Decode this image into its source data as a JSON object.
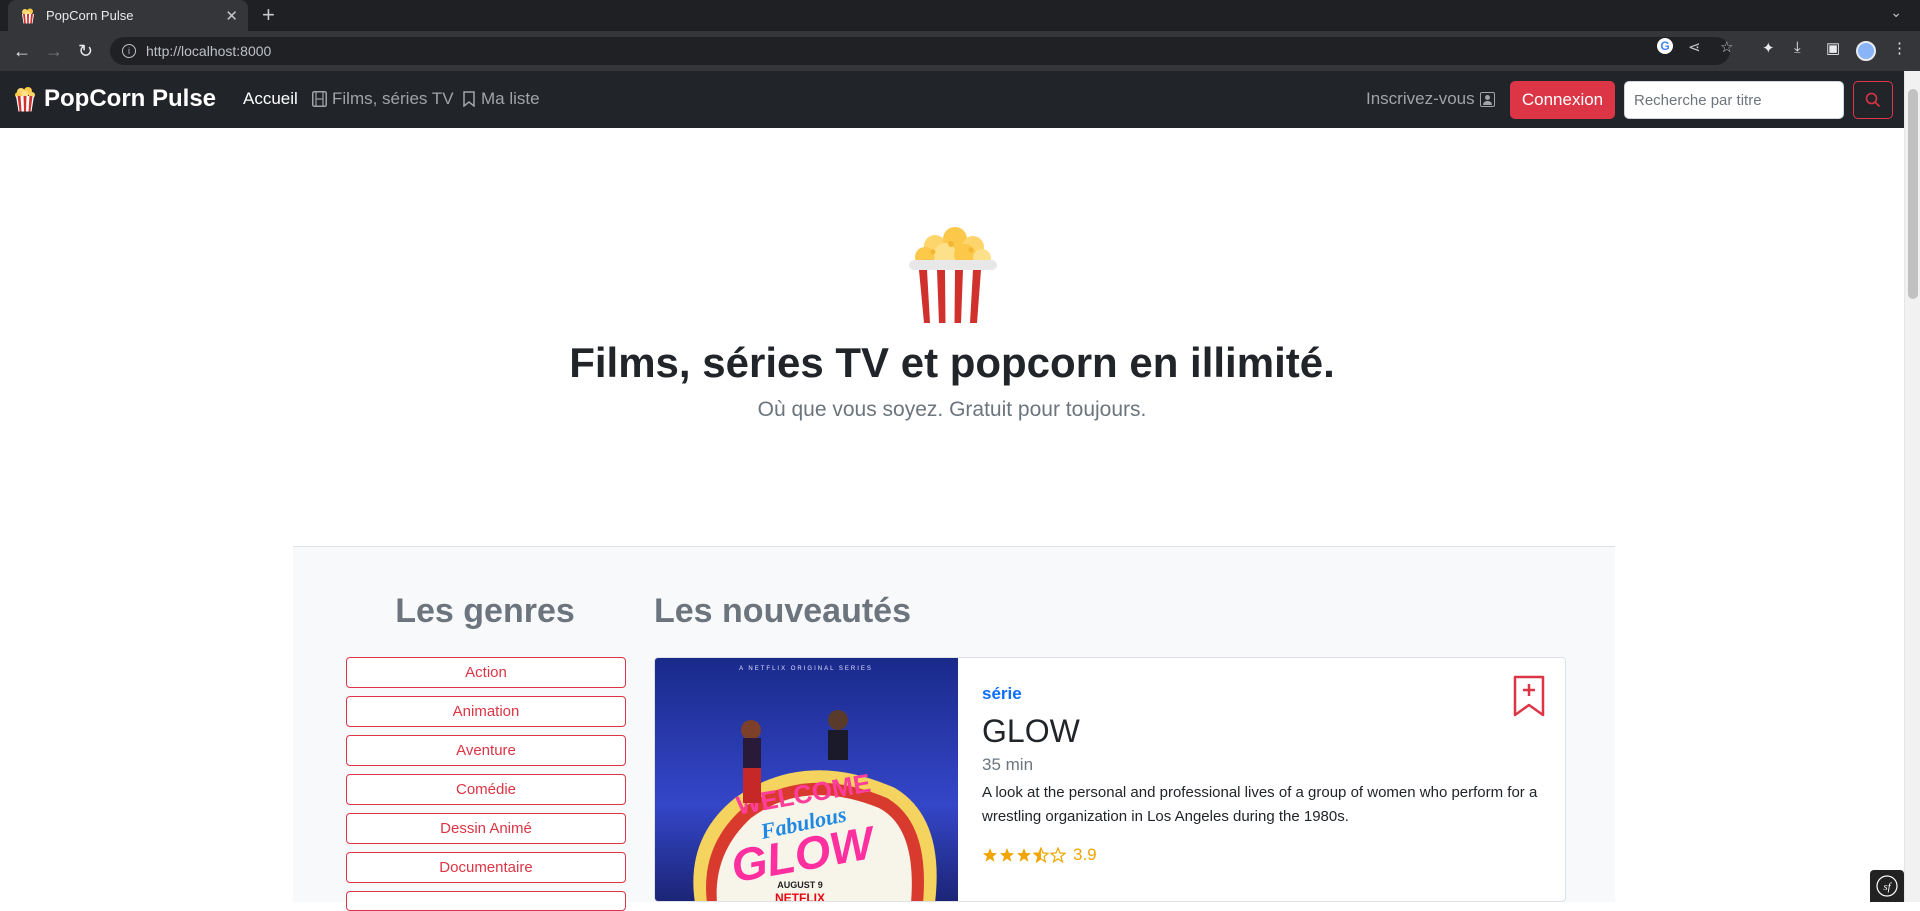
{
  "browser": {
    "tab_title": "PopCorn Pulse",
    "tab_close": "✕",
    "new_tab": "+",
    "url": "http://localhost:8000"
  },
  "nav": {
    "brand": "PopCorn Pulse",
    "links": [
      "Accueil",
      "Films, séries TV",
      "Ma liste"
    ],
    "signup": "Inscrivez-vous",
    "login": "Connexion",
    "search_placeholder": "Recherche par titre"
  },
  "hero": {
    "title": "Films, séries TV et popcorn en illimité.",
    "subtitle": "Où que vous soyez. Gratuit pour toujours."
  },
  "genres": {
    "title": "Les genres",
    "items": [
      "Action",
      "Animation",
      "Aventure",
      "Comédie",
      "Dessin Animé",
      "Documentaire"
    ]
  },
  "new_releases": {
    "title": "Les nouveautés",
    "card": {
      "type": "série",
      "title": "GLOW",
      "duration": "35 min",
      "description": "A look at the personal and professional lives of a group of women who perform for a wrestling organization in Los Angeles during the 1980s.",
      "rating": 3.9,
      "rating_text": "3.9",
      "poster_text": {
        "banner": "A NETFLIX ORIGINAL SERIES",
        "welcome": "WELCOME",
        "fabulous": "Fabulous",
        "glow": "GLOW",
        "date": "AUGUST 9",
        "netflix": "NETFLIX"
      }
    }
  },
  "colors": {
    "accent": "#dc3545",
    "link": "#0d6efd",
    "star": "#f0a500",
    "navbar": "#212529"
  }
}
